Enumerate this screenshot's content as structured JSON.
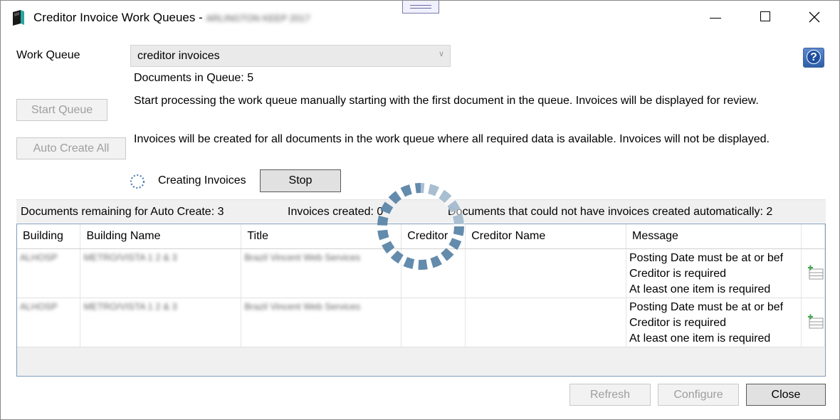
{
  "window": {
    "title": "Creditor Invoice Work Queues - ",
    "title_redacted": "ARLINGTON KEEP 2017"
  },
  "work_queue": {
    "label": "Work Queue",
    "selected": "creditor invoices",
    "documents_in_queue": "Documents in Queue: 5"
  },
  "actions": {
    "start_queue_label": "Start Queue",
    "start_queue_desc": "Start processing the work queue manually starting with the first document in the queue.  Invoices will be displayed for review.",
    "auto_create_label": "Auto Create All",
    "auto_create_desc": "Invoices will be created for all documents in the work queue where all required data is available.  Invoices will not be displayed.",
    "creating_label": "Creating Invoices",
    "stop_label": "Stop"
  },
  "status": {
    "remaining": "Documents remaining for Auto Create: 3",
    "created": "Invoices created: 0",
    "failed": "Documents that could not have invoices created automatically: 2"
  },
  "table": {
    "columns": [
      "Building",
      "Building Name",
      "Title",
      "Creditor",
      "Creditor Name",
      "Message"
    ],
    "rows": [
      {
        "building": "ALHOSP",
        "building_name": "METRO/VISTA 1 2 & 3",
        "title": "Brazil Vincent Web Services",
        "creditor": "",
        "creditor_name": "",
        "message": [
          "Posting Date must be at or bef",
          "Creditor is required",
          "At least one item is required"
        ]
      },
      {
        "building": "ALHOSP",
        "building_name": "METRO/VISTA 1 2 & 3",
        "title": "Brazil Vincent Web Services",
        "creditor": "",
        "creditor_name": "",
        "message": [
          "Posting Date must be at or bef",
          "Creditor is required",
          "At least one item is required"
        ]
      }
    ]
  },
  "footer": {
    "refresh_label": "Refresh",
    "configure_label": "Configure",
    "close_label": "Close"
  },
  "icons": {
    "app": "book-icon",
    "help": "help-icon",
    "add_row": "add-row-icon",
    "busy": "loading-spinner-icon"
  },
  "colors": {
    "spinner": "#5b85a8",
    "help_blue": "#2f5ea8",
    "add_green": "#3aa64a"
  }
}
